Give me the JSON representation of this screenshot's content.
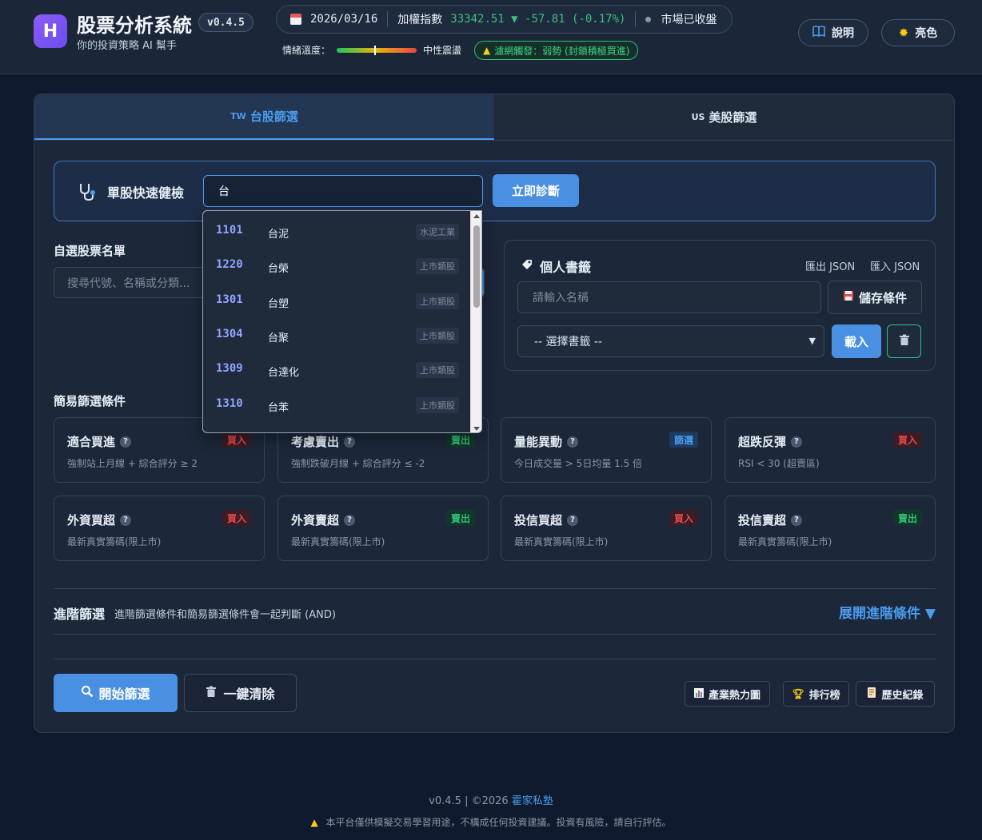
{
  "header": {
    "logo_letter": "H",
    "title": "股票分析系統",
    "version": "v0.4.5",
    "subtitle": "你的投資策略 AI 幫手",
    "date": "2026/03/16",
    "index_label": "加權指數",
    "index_value": "33342.51 ▼ -57.81 (-0.17%)",
    "market_status": "市場已收盤",
    "sentiment_label": "情緒溫度：",
    "sentiment_value": "中性震盪",
    "filter_alert": "濾網觸發：弱勢 (封鎖積極買進)",
    "help_label": "說明",
    "theme_label": "亮色"
  },
  "tabs": [
    {
      "flag": "TW",
      "label": "台股篩選",
      "active": true
    },
    {
      "flag": "US",
      "label": "美股篩選",
      "active": false
    }
  ],
  "quick_check": {
    "label": "單股快速健檢",
    "input_value": "台",
    "button": "立即診斷"
  },
  "watchlist": {
    "title": "自選股票名單",
    "search_placeholder": "搜尋代號、名稱或分類..."
  },
  "bookmarks": {
    "title": "個人書籤",
    "export_label": "匯出 JSON",
    "import_label": "匯入 JSON",
    "name_placeholder": "請輸入名稱",
    "save_button": "儲存條件",
    "select_value": "-- 選擇書籤 --",
    "load_button": "載入"
  },
  "simple_filters": {
    "title": "簡易篩選條件",
    "cards": [
      {
        "title": "適合買進",
        "desc": "強制站上月線 + 綜合評分 ≥ 2",
        "tag": "買入",
        "tag_type": "buy"
      },
      {
        "title": "考慮賣出",
        "desc": "強制跌破月線 + 綜合評分 ≤ -2",
        "tag": "賣出",
        "tag_type": "sell"
      },
      {
        "title": "量能異動",
        "desc": "今日成交量 > 5日均量 1.5 倍",
        "tag": "篩選",
        "tag_type": "screen"
      },
      {
        "title": "超跌反彈",
        "desc": "RSI < 30 (超賣區)",
        "tag": "買入",
        "tag_type": "buy"
      },
      {
        "title": "外資買超",
        "desc": "最新真實籌碼(限上市)",
        "tag": "買入",
        "tag_type": "buy"
      },
      {
        "title": "外資賣超",
        "desc": "最新真實籌碼(限上市)",
        "tag": "賣出",
        "tag_type": "sell"
      },
      {
        "title": "投信買超",
        "desc": "最新真實籌碼(限上市)",
        "tag": "買入",
        "tag_type": "buy"
      },
      {
        "title": "投信賣超",
        "desc": "最新真實籌碼(限上市)",
        "tag": "賣出",
        "tag_type": "sell"
      }
    ]
  },
  "advanced": {
    "title": "進階篩選",
    "desc": "進階篩選條件和簡易篩選條件會一起判斷 (AND)",
    "expand": "展開進階條件 ▼"
  },
  "actions": {
    "start": "開始篩選",
    "clear": "一鍵清除",
    "heatmap": "產業熱力圖",
    "ranking": "排行榜",
    "history": "歷史紀錄"
  },
  "autocomplete": [
    {
      "code": "1101",
      "name": "台泥",
      "category": "水泥工業"
    },
    {
      "code": "1220",
      "name": "台榮",
      "category": "上市類股"
    },
    {
      "code": "1301",
      "name": "台塑",
      "category": "上市類股"
    },
    {
      "code": "1304",
      "name": "台聚",
      "category": "上市類股"
    },
    {
      "code": "1309",
      "name": "台達化",
      "category": "上市類股"
    },
    {
      "code": "1310",
      "name": "台苯",
      "category": "上市類股"
    }
  ],
  "footer": {
    "version": "v0.4.5 | ©2026",
    "brand": "霍家私塾",
    "disclaimer": "本平台僅供模擬交易學習用途，不構成任何投資建議。投資有風險，請自行評估。"
  },
  "colors": {
    "accent": "#4a90e2",
    "buy": "#e5484d",
    "sell": "#2fbf71",
    "background": "#0f1a2e"
  }
}
